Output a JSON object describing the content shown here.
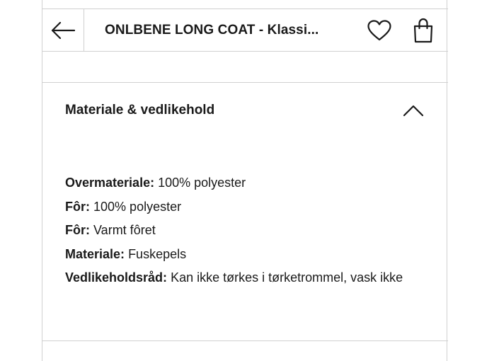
{
  "header": {
    "title": "ONLBENE LONG COAT - Klassi...",
    "icons": {
      "back": "arrow-left-icon",
      "wishlist": "heart-icon",
      "bag": "shopping-bag-icon"
    }
  },
  "accordion": {
    "title": "Materiale & vedlikehold",
    "state": "expanded",
    "icon": "chevron-up-icon",
    "details": [
      {
        "label": "Overmateriale:",
        "value": "100% polyester"
      },
      {
        "label": "Fôr:",
        "value": "100% polyester"
      },
      {
        "label": "Fôr:",
        "value": "Varmt fôret"
      },
      {
        "label": "Materiale:",
        "value": "Fuskepels"
      },
      {
        "label": "Vedlikeholdsråd:",
        "value": "Kan ikke tørkes i tørketrommel, vask ikke"
      }
    ]
  }
}
